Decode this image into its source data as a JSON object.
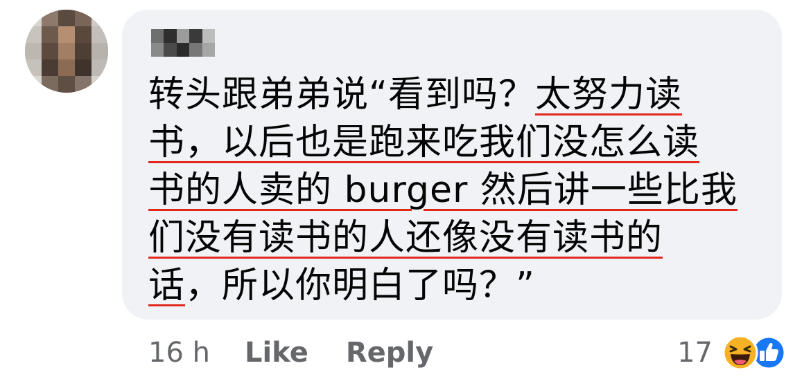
{
  "comment": {
    "author_redacted": true,
    "lines": [
      [
        {
          "text": "转头跟弟弟说“看到吗？",
          "underline": false
        },
        {
          "text": "太努力读",
          "underline": true
        }
      ],
      [
        {
          "text": "书，以后也是跑来吃我们没怎么读",
          "underline": true
        }
      ],
      [
        {
          "text": "书的人卖的 burger 然后讲一些比我",
          "underline": true
        }
      ],
      [
        {
          "text": "们没有读书的人还像没有读书的",
          "underline": true
        }
      ],
      [
        {
          "text": "话",
          "underline": true
        },
        {
          "text": "，所以你明白了吗？”",
          "underline": false
        }
      ]
    ],
    "underline_color": "#e0281c",
    "bubble_color": "#f0f2f5",
    "text_color": "#050505"
  },
  "footer": {
    "time": "16 h",
    "like_label": "Like",
    "reply_label": "Reply",
    "muted_color": "#65676b"
  },
  "reactions": {
    "count": "17",
    "icons": [
      "haha-icon",
      "like-icon"
    ],
    "haha_color": "#f7b125",
    "like_color": "#1877f2"
  },
  "avatar": {
    "pixelated": true
  }
}
